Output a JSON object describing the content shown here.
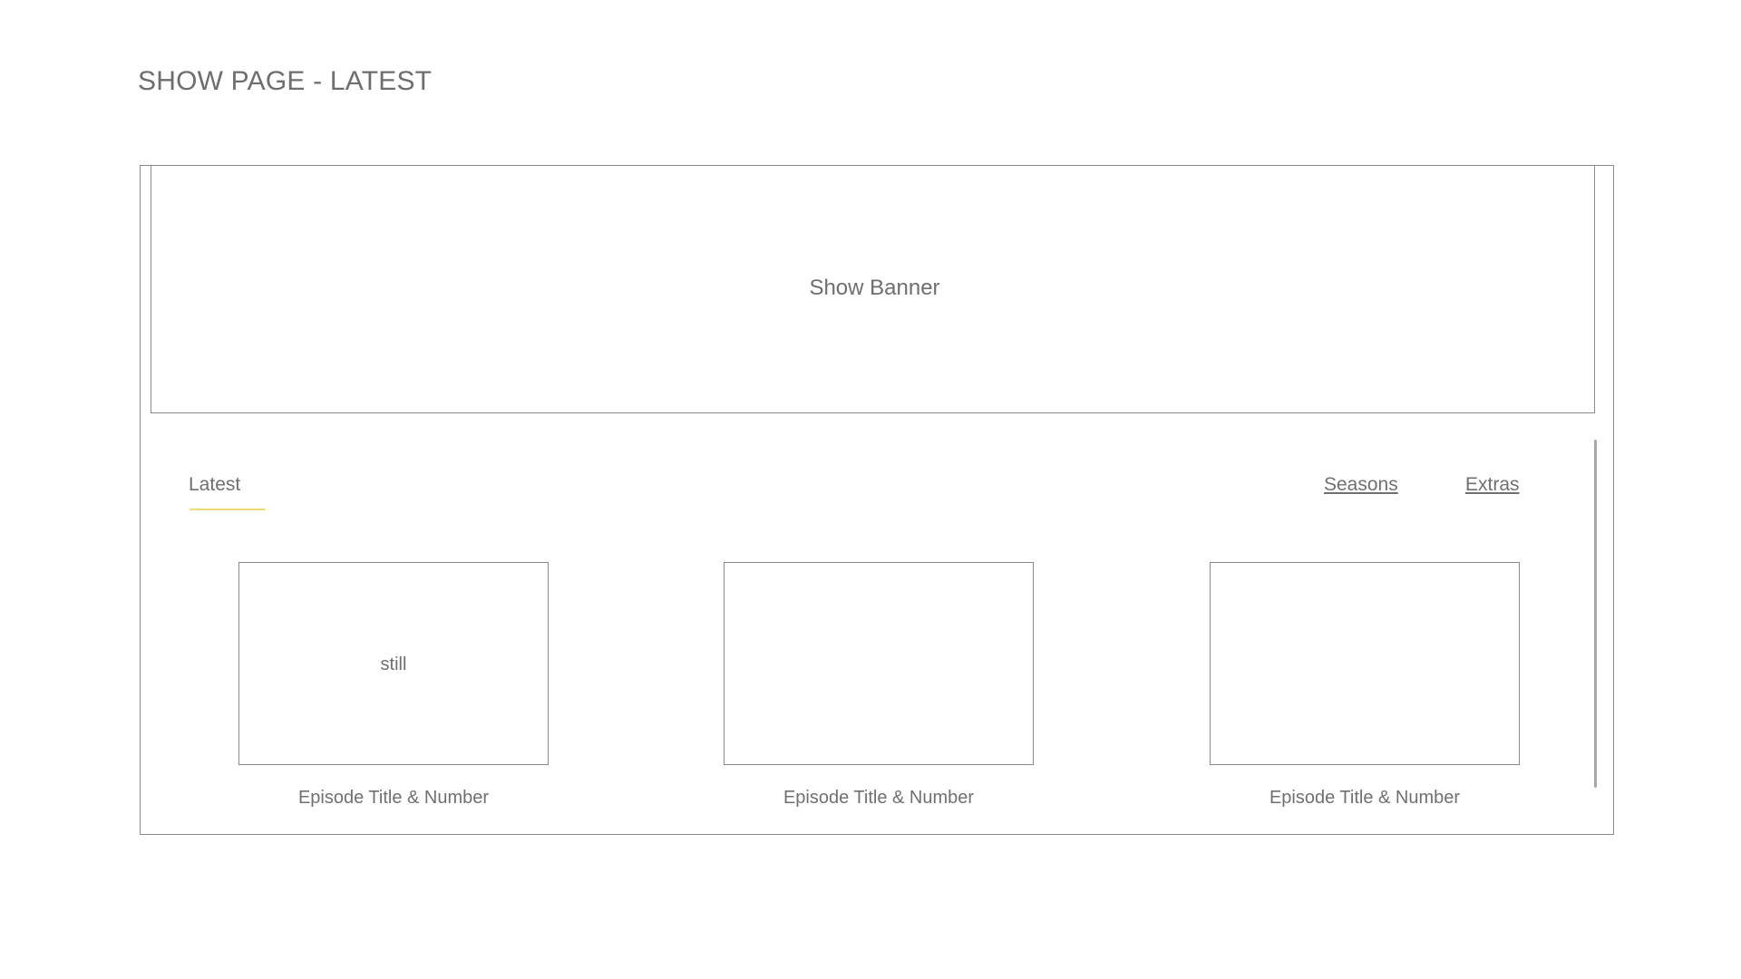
{
  "page": {
    "title": "SHOW PAGE - LATEST"
  },
  "banner": {
    "label": "Show Banner"
  },
  "tabs": {
    "latest": "Latest",
    "seasons": "Seasons",
    "extras": "Extras",
    "active": "Latest",
    "indicator_color": "#ecdc78"
  },
  "episodes": [
    {
      "still_label": "still",
      "title": "Episode Title & Number"
    },
    {
      "still_label": "",
      "title": "Episode Title & Number"
    },
    {
      "still_label": "",
      "title": "Episode Title & Number"
    }
  ]
}
